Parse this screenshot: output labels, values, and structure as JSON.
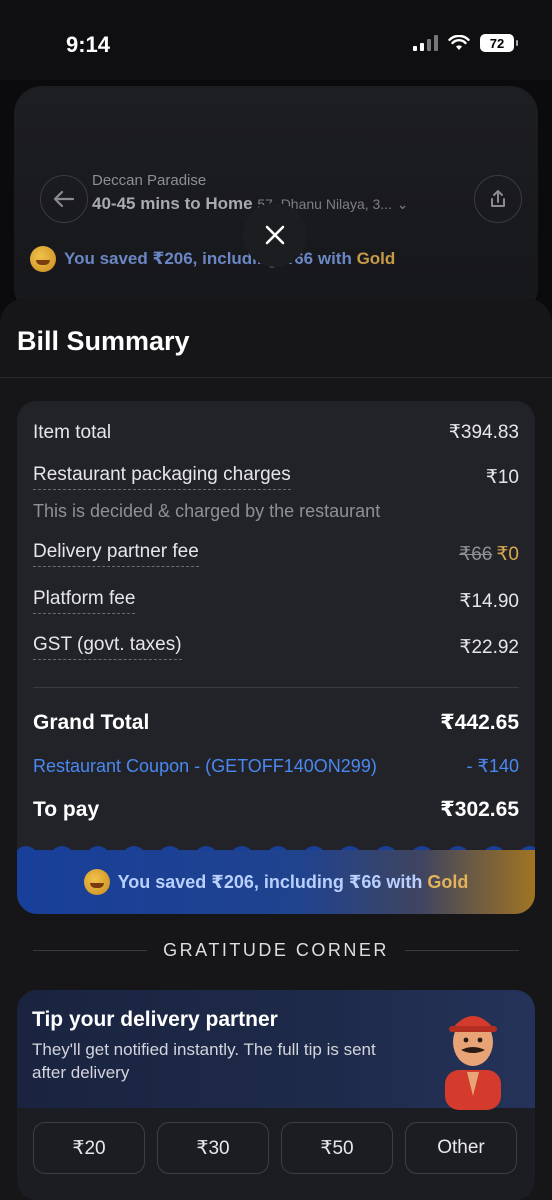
{
  "status_bar": {
    "time": "9:14",
    "battery": "72"
  },
  "background": {
    "restaurant": "Deccan Paradise",
    "eta": "40-45 mins to Home",
    "address": "57, Dhanu Nilaya, 3...",
    "saved_prefix": "You saved ₹206, including ₹66 with ",
    "saved_gold": "Gold"
  },
  "sheet": {
    "title": "Bill Summary"
  },
  "bill": {
    "item_total": {
      "label": "Item total",
      "value": "₹394.83"
    },
    "packaging": {
      "label": "Restaurant packaging charges",
      "value": "₹10",
      "note": "This is decided & charged by the restaurant"
    },
    "delivery": {
      "label": "Delivery partner fee",
      "original": "₹66",
      "value": "₹0"
    },
    "platform": {
      "label": "Platform fee",
      "value": "₹14.90"
    },
    "gst": {
      "label": "GST (govt. taxes)",
      "value": "₹22.92"
    },
    "grand_total": {
      "label": "Grand Total",
      "value": "₹442.65"
    },
    "coupon": {
      "label": "Restaurant Coupon - (GETOFF140ON299)",
      "value": "- ₹140"
    },
    "to_pay": {
      "label": "To pay",
      "value": "₹302.65"
    },
    "saved_prefix": "You saved ₹206, including ₹66 with ",
    "saved_gold": "Gold"
  },
  "gratitude": {
    "heading": "GRATITUDE CORNER"
  },
  "tip": {
    "title": "Tip your delivery partner",
    "subtitle": "They'll get notified instantly. The full tip is sent after delivery",
    "options": [
      "₹20",
      "₹30",
      "₹50",
      "Other"
    ]
  },
  "colors": {
    "accent_blue": "#4a88f0",
    "gold": "#d9a84c",
    "background": "#161619",
    "card": "#222329"
  }
}
